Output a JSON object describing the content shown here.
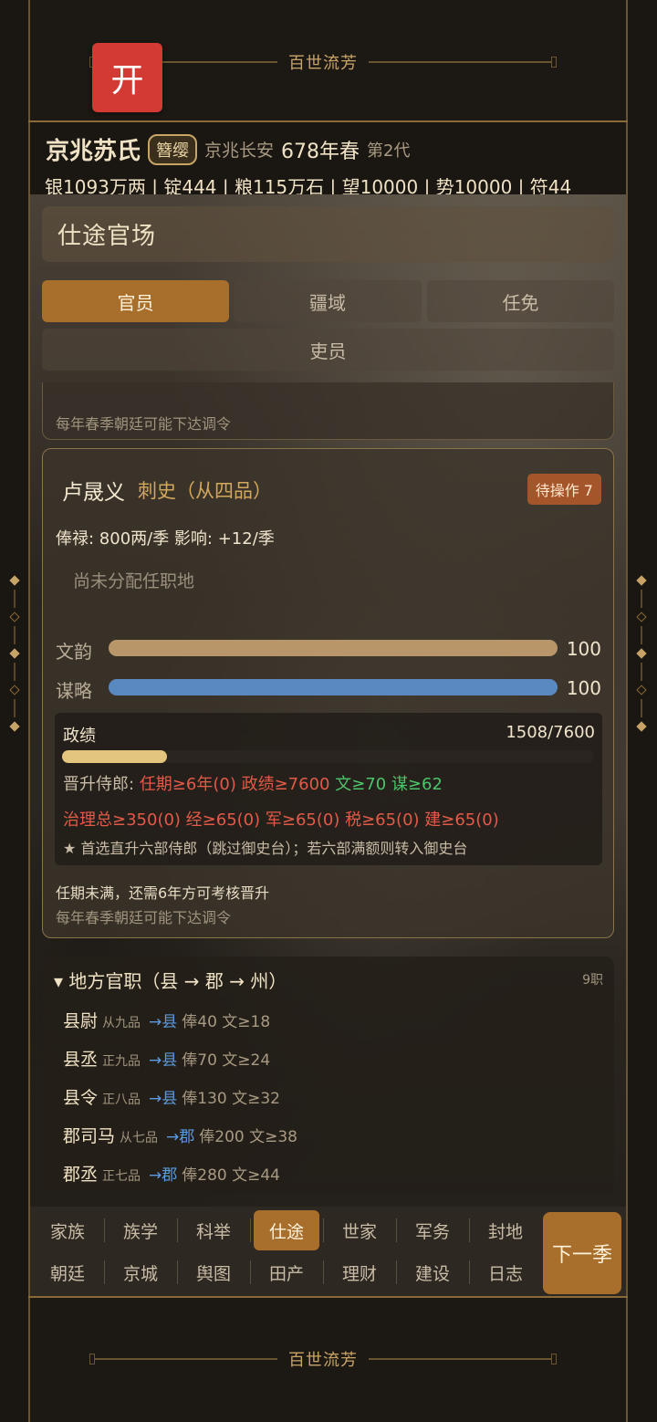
{
  "top_banner": {
    "title": "百世流芳",
    "open_button": "开"
  },
  "bottom_banner": {
    "title": "百世流芳"
  },
  "header": {
    "clan_name": "京兆苏氏",
    "title_badge": "簪缨",
    "location": "京兆长安",
    "year": "678年春",
    "generation": "第2代",
    "resources": "银1093万两 | 锭444 | 粮115万石 | 望10000 | 势10000 | 符44"
  },
  "panel": {
    "title": "仕途官场",
    "tabs": [
      "官员",
      "疆域",
      "任免",
      "吏员"
    ],
    "active_tab": "官员",
    "top_notice": "每年春季朝廷可能下达调令"
  },
  "official": {
    "name": "卢晟义",
    "rank": "刺史（从四品）",
    "pending": "待操作 7",
    "salary": "俸禄: 800两/季   影响: +12/季",
    "unassigned": "尚未分配任职地",
    "stats": [
      {
        "label": "文韵",
        "value": "100",
        "ratio": 1.0,
        "color": "#b8966a"
      },
      {
        "label": "谋略",
        "value": "100",
        "ratio": 1.0,
        "color": "#5a88c0"
      }
    ],
    "merit": {
      "label": "政绩",
      "value": "1508/7600",
      "ratio": 0.198,
      "req_prefix": "晋升侍郎:",
      "req_term": "任期≥6年(0)",
      "req_merit": "政绩≥7600",
      "req_wen": "文≥70",
      "req_mou": "谋≥62",
      "req_line2": "治理总≥350(0)  经≥65(0)  军≥65(0)  税≥65(0)  建≥65(0)",
      "note": "★ 首选直升六部侍郎（跳过御史台）；若六部满额则转入御史台"
    },
    "term_msg": "任期未满，还需6年方可考核晋升",
    "notice": "每年春季朝廷可能下达调令"
  },
  "local_posts": {
    "header": "▾ 地方官职（县 → 郡 → 州）",
    "count": "9职",
    "rows": [
      {
        "name": "县尉",
        "grade": "从九品",
        "to": "→县",
        "info": "俸40 文≥18"
      },
      {
        "name": "县丞",
        "grade": "正九品",
        "to": "→县",
        "info": "俸70 文≥24"
      },
      {
        "name": "县令",
        "grade": "正八品",
        "to": "→县",
        "info": "俸130 文≥32"
      },
      {
        "name": "郡司马",
        "grade": "从七品",
        "to": "→郡",
        "info": "俸200 文≥38"
      },
      {
        "name": "郡丞",
        "grade": "正七品",
        "to": "→郡",
        "info": "俸280 文≥44"
      }
    ]
  },
  "nav": {
    "row1": [
      "家族",
      "族学",
      "科举",
      "仕途",
      "世家",
      "军务",
      "封地"
    ],
    "row2": [
      "朝廷",
      "京城",
      "舆图",
      "田产",
      "理财",
      "建设",
      "日志"
    ],
    "active": "仕途",
    "next_button": "下一季"
  }
}
